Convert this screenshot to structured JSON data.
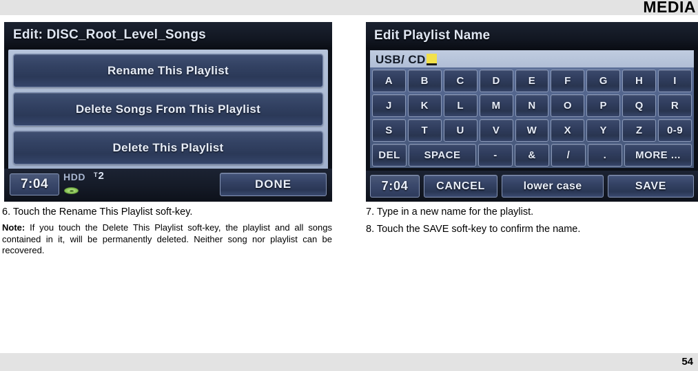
{
  "header": {
    "section_title": "MEDIA"
  },
  "footer": {
    "page_number": "54"
  },
  "left_screenshot": {
    "title": "Edit: DISC_Root_Level_Songs",
    "options": [
      "Rename This Playlist",
      "Delete Songs From This Playlist",
      "Delete This Playlist"
    ],
    "status_bar": {
      "clock": "7:04",
      "source": "HDD",
      "track_prefix": "T",
      "track_number": "2",
      "done_label": "DONE"
    }
  },
  "right_screenshot": {
    "title": "Edit Playlist Name",
    "text_field": {
      "value": "USB/ CD"
    },
    "keyboard_rows": [
      [
        "A",
        "B",
        "C",
        "D",
        "E",
        "F",
        "G",
        "H",
        "I"
      ],
      [
        "J",
        "K",
        "L",
        "M",
        "N",
        "O",
        "P",
        "Q",
        "R"
      ],
      [
        "S",
        "T",
        "U",
        "V",
        "W",
        "X",
        "Y",
        "Z",
        "0-9"
      ],
      [
        "DEL",
        "SPACE",
        "-",
        "&",
        "/",
        ".",
        "MORE ..."
      ]
    ],
    "bottom_bar": {
      "clock": "7:04",
      "cancel_label": "CANCEL",
      "case_label": "lower case",
      "save_label": "SAVE"
    }
  },
  "left_column": {
    "step6": "6. Touch the Rename This Playlist soft-key.",
    "note_label": "Note:",
    "note_text": " If you touch the Delete This Playlist soft-key, the playlist and all songs contained in it, will be permanently deleted. Neither  song nor playlist can be recovered."
  },
  "right_column": {
    "step7": "7. Type in a new name for the playlist.",
    "step8": "8. Touch the SAVE soft-key to confirm the name."
  }
}
